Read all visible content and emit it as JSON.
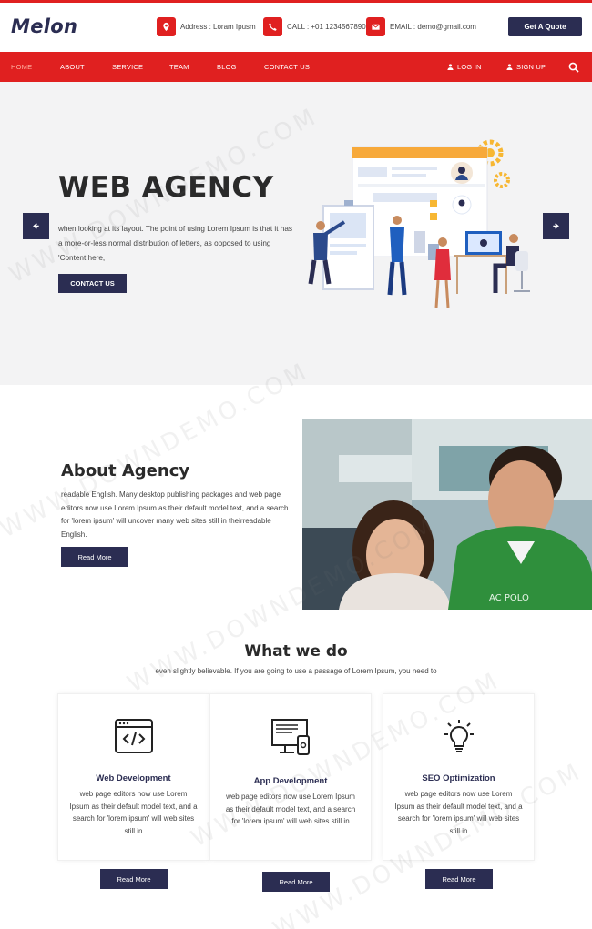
{
  "header": {
    "logo": "Melon",
    "address": "Address : Loram Ipusm",
    "call": "CALL : +01 1234567890",
    "email": "EMAIL : demo@gmail.com",
    "quote_button": "Get A Quote"
  },
  "nav": {
    "items": [
      "HOME",
      "ABOUT",
      "SERVICE",
      "TEAM",
      "BLOG",
      "CONTACT US"
    ],
    "active": "HOME",
    "login": "LOG IN",
    "signup": "SIGN UP"
  },
  "hero": {
    "title": "WEB AGENCY",
    "text": "when looking at its layout. The point of using Lorem Ipsum is that it has a more-or-less normal distribution of letters, as opposed to using 'Content here,",
    "button": "CONTACT US"
  },
  "about": {
    "title": "About Agency",
    "text": "readable English. Many desktop publishing packages and web page editors now use Lorem Ipsum as their default model text, and a search for 'lorem ipsum' will uncover many web sites still in theirreadable English.",
    "button": "Read More"
  },
  "services": {
    "title": "What we do",
    "subtitle": "even slightly believable. If you are going to use a passage of Lorem Ipsum, you need to",
    "cards": [
      {
        "title": "Web Development",
        "text": "web page editors now use Lorem Ipsum as their default model text, and a search for 'lorem ipsum' will web sites still in",
        "button": "Read More",
        "icon": "code-window-icon"
      },
      {
        "title": "App Development",
        "text": "web page editors now use Lorem Ipsum as their default model text, and a search for 'lorem ipsum' will web sites still in",
        "button": "Read More",
        "icon": "monitor-device-icon"
      },
      {
        "title": "SEO Optimization",
        "text": "web page editors now use Lorem Ipsum as their default model text, and a search for 'lorem ipsum' will web sites still in",
        "button": "Read More",
        "icon": "lightbulb-icon"
      }
    ]
  },
  "watermark": "WWW.DOWNDEMO.COM",
  "colors": {
    "accent": "#e02020",
    "navy": "#2b2d52",
    "hero_bg": "#f3f3f4"
  }
}
